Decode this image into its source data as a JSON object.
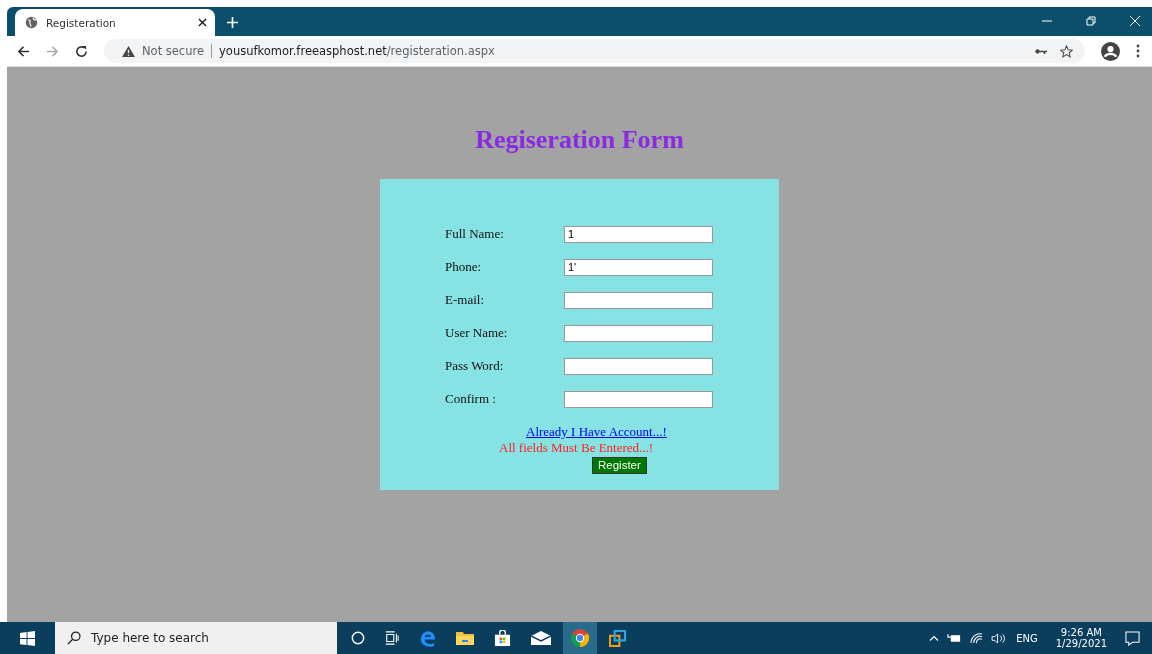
{
  "browser": {
    "tab_title": "Registeration",
    "security": "Not secure",
    "url_host": "yousufkomor.freeasphost.net",
    "url_path": "/registeration.aspx"
  },
  "page": {
    "title": "Regiseration Form",
    "fields": [
      {
        "label": "Full Name:",
        "value": "1"
      },
      {
        "label": "Phone:",
        "value": "1'"
      },
      {
        "label": "E-mail:"
      },
      {
        "label": "User Name:"
      },
      {
        "label": "Pass Word:"
      },
      {
        "label": "Confirm :"
      }
    ],
    "link": "Already I Have Account...!",
    "error": "All fields Must Be Entered...!",
    "button": "Register"
  },
  "taskbar": {
    "search_placeholder": "Type here to search",
    "language": "ENG",
    "time": "9:26 AM",
    "date": "1/29/2021"
  }
}
